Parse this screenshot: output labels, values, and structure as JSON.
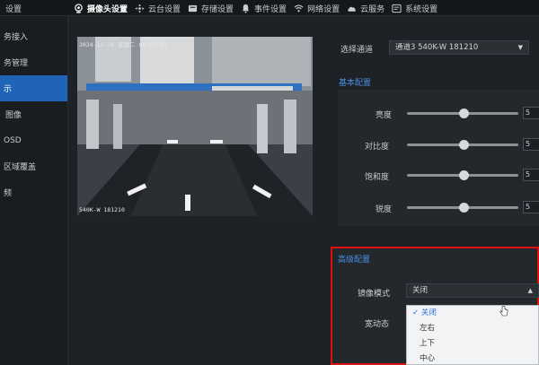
{
  "app": {
    "title": "设置"
  },
  "tabs": [
    {
      "label": "摄像头设置",
      "icon": "camera-icon",
      "active": true
    },
    {
      "label": "云台设置",
      "icon": "ptz-icon",
      "active": false
    },
    {
      "label": "存储设置",
      "icon": "storage-icon",
      "active": false
    },
    {
      "label": "事件设置",
      "icon": "bell-icon",
      "active": false
    },
    {
      "label": "网络设置",
      "icon": "wifi-icon",
      "active": false
    },
    {
      "label": "云服务",
      "icon": "cloud-icon",
      "active": false
    },
    {
      "label": "系统设置",
      "icon": "system-icon",
      "active": false
    }
  ],
  "sidebar": {
    "items": [
      {
        "label": "务接入"
      },
      {
        "label": "务管理"
      },
      {
        "label": "示",
        "active": true
      },
      {
        "label": "图像"
      },
      {
        "label": "OSD"
      },
      {
        "label": "区域覆盖"
      },
      {
        "label": "频"
      }
    ]
  },
  "preview": {
    "osd_time": "2024-11-26 星期二 09:05:43",
    "osd_name": "540K-W  181210"
  },
  "channel": {
    "label": "选择通道",
    "value": "通道3 540K-W  181210"
  },
  "basic": {
    "title": "基本配置",
    "sliders": [
      {
        "label": "亮度",
        "value": "5",
        "level": 0.5
      },
      {
        "label": "对比度",
        "value": "5",
        "level": 0.5
      },
      {
        "label": "饱和度",
        "value": "5",
        "level": 0.5
      },
      {
        "label": "锐度",
        "value": "5",
        "level": 0.5
      }
    ]
  },
  "advanced": {
    "title": "高级配置",
    "mirror_label": "镜像模式",
    "mirror_value": "关闭",
    "wdr_label": "宽动态",
    "options": [
      "关闭",
      "左右",
      "上下",
      "中心"
    ],
    "selected_mark": "✓"
  },
  "colors": {
    "accent": "#2064b8",
    "highlight": "#e01010",
    "section": "#4a8fe0"
  }
}
